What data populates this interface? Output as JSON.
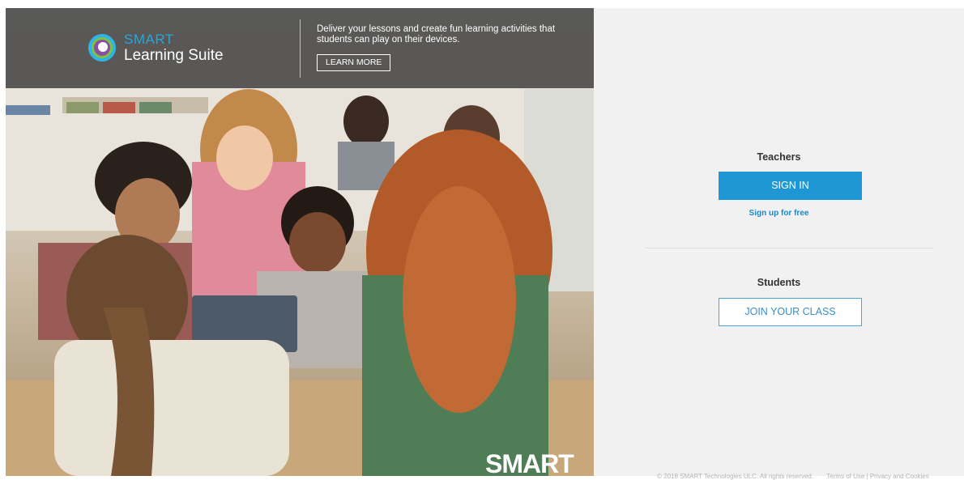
{
  "hero": {
    "logo": {
      "brand": "SMART",
      "product": "Learning Suite"
    },
    "promo_text": "Deliver your lessons and create fun learning activities that students can play on their devices.",
    "learn_more_label": "LEARN MORE",
    "watermark": "SMART"
  },
  "teachers": {
    "heading": "Teachers",
    "sign_in_label": "SIGN IN",
    "signup_label": "Sign up for free"
  },
  "students": {
    "heading": "Students",
    "join_label": "JOIN YOUR CLASS"
  },
  "footer": {
    "copyright": "© 2018 SMART Technologies ULC. All rights reserved.",
    "links": "Terms of Use | Privacy and Cookies"
  },
  "colors": {
    "accent": "#1f97d4",
    "brand_blue": "#2aa6d8",
    "panel_bg": "#f1f1f1",
    "topbar_bg": "#464646"
  }
}
